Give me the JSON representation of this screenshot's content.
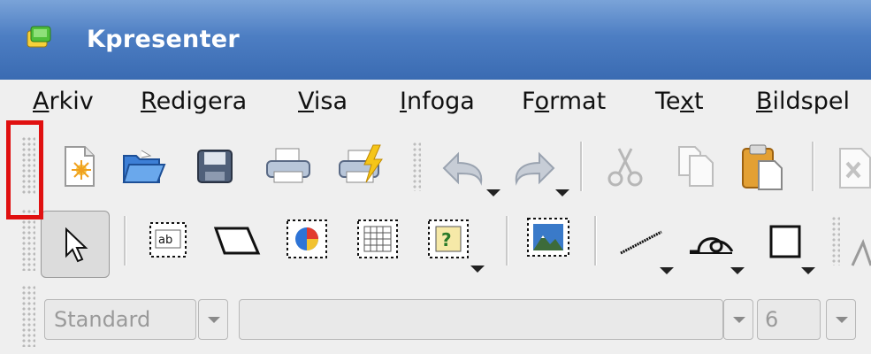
{
  "window": {
    "title": "Kpresenter"
  },
  "menu": [
    {
      "label": "Arkiv"
    },
    {
      "label": "Redigera"
    },
    {
      "label": "Visa"
    },
    {
      "label": "Infoga"
    },
    {
      "label": "Format"
    },
    {
      "label": "Text"
    },
    {
      "label": "Bildspel"
    }
  ],
  "format_bar": {
    "style_value": "Standard",
    "font_value": "",
    "size_value": "6"
  }
}
